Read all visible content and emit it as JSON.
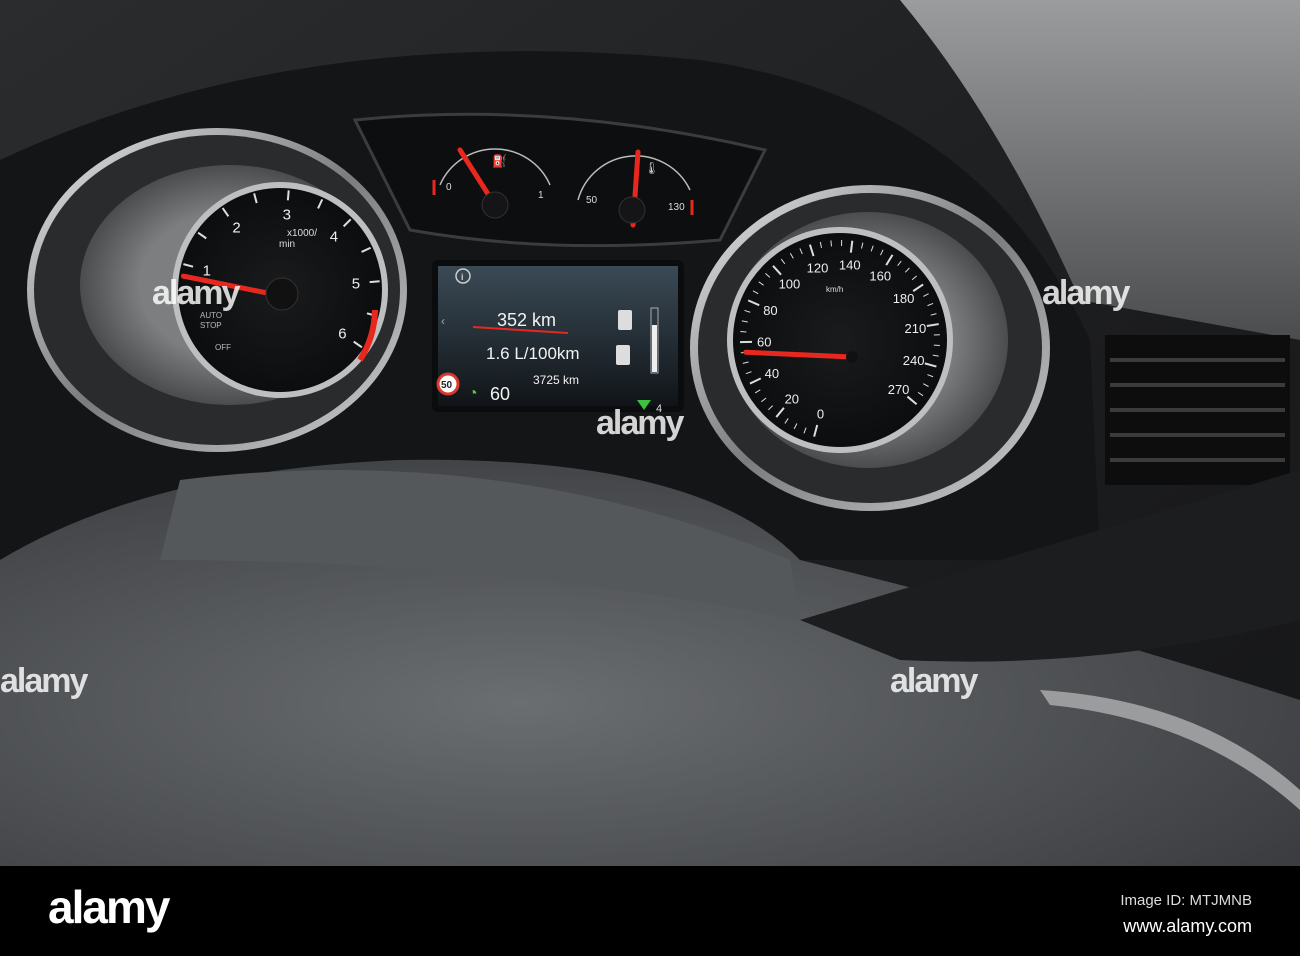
{
  "tachometer": {
    "numbers": [
      "1",
      "2",
      "3",
      "4",
      "5",
      "6"
    ],
    "unit": "x1000/",
    "unit2": "min",
    "auto_stop": "AUTO",
    "auto_stop2": "STOP",
    "off": "OFF",
    "needle_rpm": 1.0
  },
  "fuel_gauge": {
    "min_label": "0",
    "max_label": "1",
    "level_fraction": 0.2
  },
  "temp_gauge": {
    "min_label": "50",
    "max_label": "130",
    "value": 90
  },
  "speedometer": {
    "numbers": [
      "0",
      "20",
      "40",
      "60",
      "80",
      "100",
      "120",
      "140",
      "160",
      "180",
      "210",
      "240",
      "270"
    ],
    "unit": "km/h",
    "needle_kmh": 55
  },
  "display": {
    "range": "352 km",
    "consumption": "1.6 L/100km",
    "odometer": "3725 km",
    "speed_limit": "50",
    "cruise_speed": "60",
    "gear_indicator": "4",
    "colors": {
      "needle": "#e8281e",
      "cruise": "#5fc83a",
      "limit_ring": "#d93a2e"
    }
  },
  "watermarks": [
    "alamy",
    "alamy",
    "alamy",
    "alamy",
    "alamy"
  ],
  "footer": {
    "logo": "alamy",
    "image_id": "Image ID: MTJMNB",
    "url": "www.alamy.com"
  }
}
